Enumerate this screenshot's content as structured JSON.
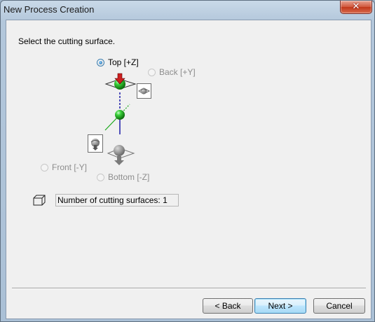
{
  "window": {
    "title": "New Process Creation",
    "close_glyph": "✕"
  },
  "content": {
    "instruction": "Select the cutting surface.",
    "count_text": "Number of cutting surfaces: 1"
  },
  "surfaces": {
    "top": {
      "label": "Top [+Z]",
      "checked": true,
      "enabled": true
    },
    "back": {
      "label": "Back [+Y]",
      "checked": false,
      "enabled": false
    },
    "front": {
      "label": "Front [-Y]",
      "checked": false,
      "enabled": false
    },
    "bottom": {
      "label": "Bottom [-Z]",
      "checked": false,
      "enabled": false
    }
  },
  "buttons": {
    "back": "< Back",
    "next": "Next >",
    "cancel": "Cancel"
  },
  "icons": {
    "origin": "green-sphere-icon",
    "cube": "cube-outline-icon",
    "arrow": "red-down-arrow-icon"
  },
  "colors": {
    "sphere": "#22b022",
    "arrow": "#cc1f1f",
    "z_axis": "#1a1aa8",
    "y_axis": "#1aa81a"
  }
}
